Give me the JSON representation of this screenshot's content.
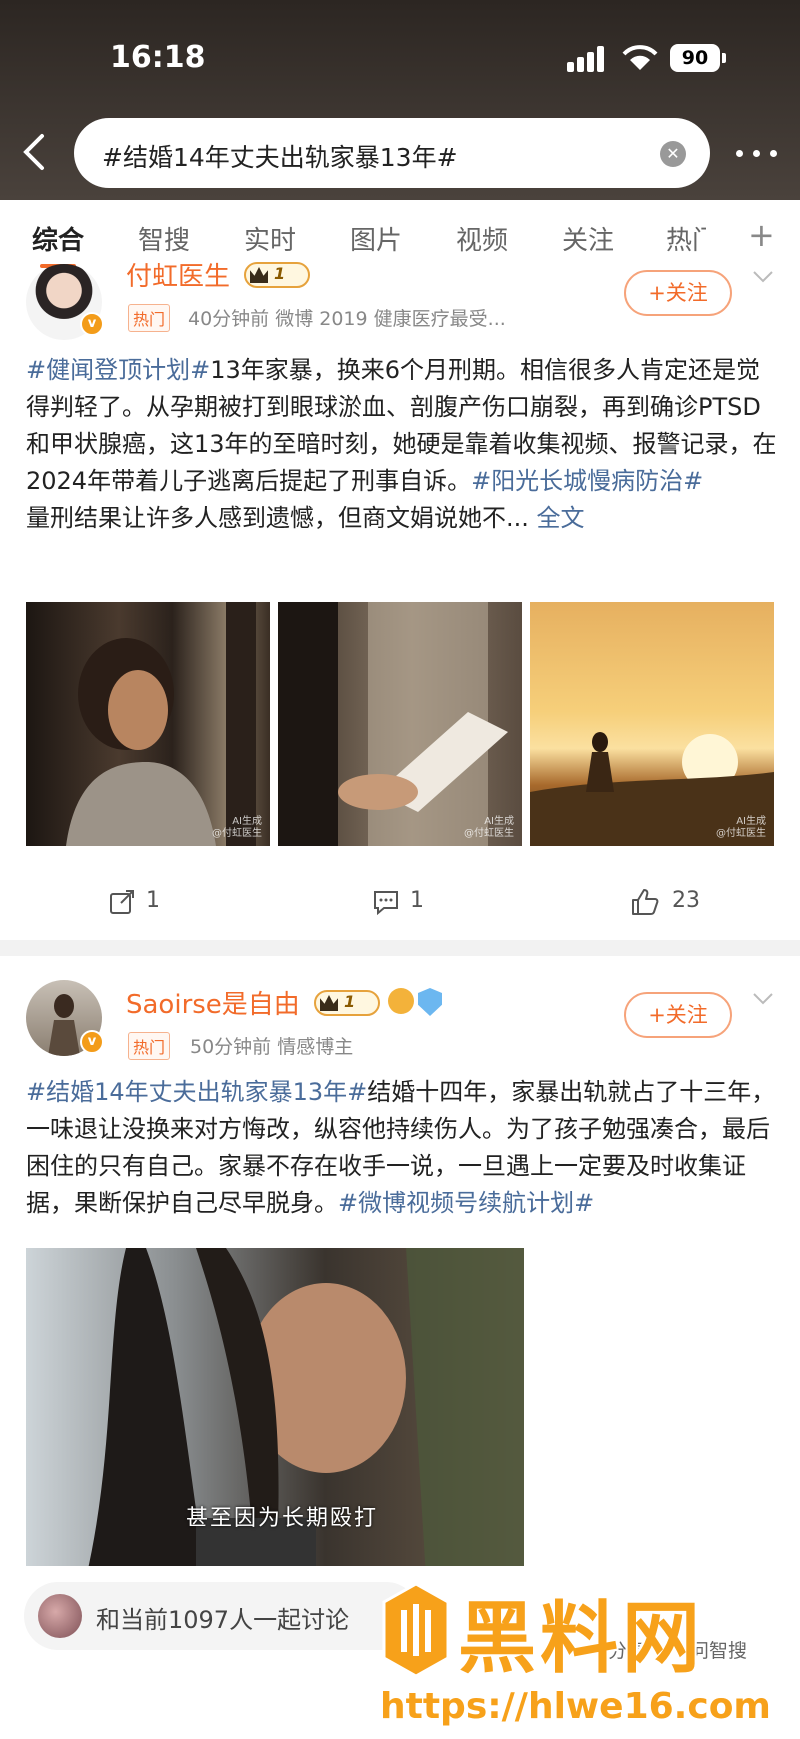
{
  "status": {
    "time": "16:18",
    "battery": "90"
  },
  "search": {
    "query": "#结婚14年丈夫出轨家暴13年#"
  },
  "tabs": [
    "综合",
    "智搜",
    "实时",
    "图片",
    "视频",
    "关注",
    "热门"
  ],
  "post1": {
    "author": "付虹医生",
    "level": "1",
    "hot_badge": "热门",
    "meta": "40分钟前  微博 2019 健康医疗最受...",
    "follow_label": "+关注",
    "tag1": "#健闻登顶计划#",
    "text1": "13年家暴，换来6个月刑期。相信很多人肯定还是觉得判轻了。从孕期被打到眼球淤血、剖腹产伤口崩裂，再到确诊PTSD和甲状腺癌，这13年的至暗时刻，她硬是靠着收集视频、报警记录，在2024年带着儿子逃离后提起了刑事自诉。",
    "tag2": "#阳光长城慢病防治#",
    "text2": "量刑结果让许多人感到遗憾，但商文娟说她不...",
    "full_label": "全文",
    "image_wm": "AI生成\n@付虹医生",
    "reposts": "1",
    "comments": "1",
    "likes": "23"
  },
  "post2": {
    "author": "Saoirse是自由",
    "level": "1",
    "hot_badge": "热门",
    "meta": "50分钟前  情感博主",
    "follow_label": "+关注",
    "tag1": "#结婚14年丈夫出轨家暴13年#",
    "text1": "结婚十四年，家暴出轨就占了十三年，一味退让没换来对方悔改，纵容他持续伤人。为了孩子勉强凑合，最后困住的只有自己。家暴不存在收手一说，一旦遇上一定要及时收集证据，果断保护自己尽早脱身。",
    "tag2": "#微博视频号续航计划#",
    "video_caption": "甚至因为长期殴打"
  },
  "bottom": {
    "join_text": "和当前1097人一起讨论",
    "share_label": "分享",
    "ask_label": "问智搜"
  },
  "watermark": {
    "brand": "黑料网",
    "url": "https://hlwe16.com"
  },
  "colors": {
    "accent": "#f26b2a",
    "topic": "#4a6c9a",
    "brand": "#f7a11a"
  }
}
